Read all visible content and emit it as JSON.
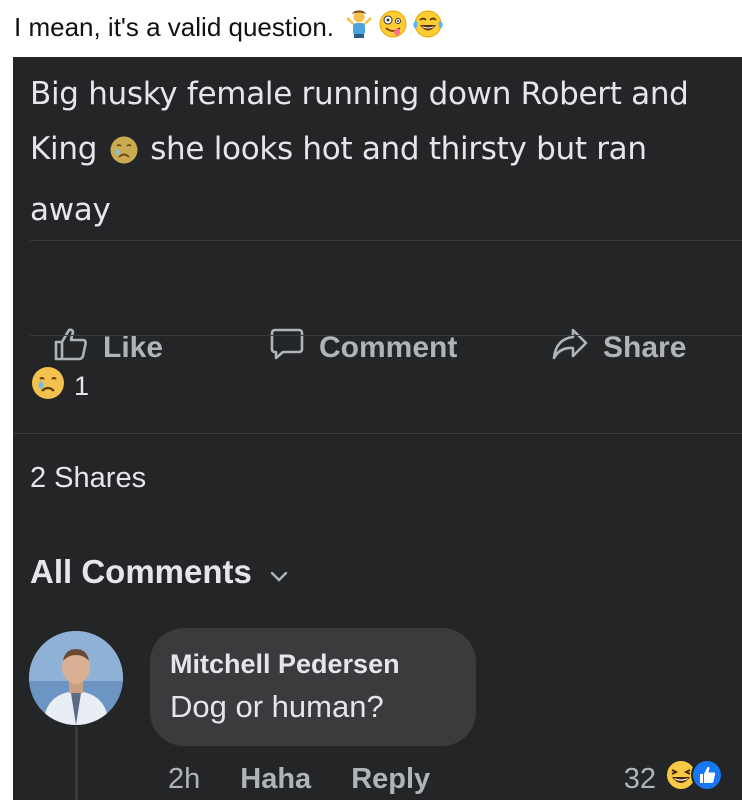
{
  "caption": {
    "text": "I mean, it's a valid question.",
    "emojis": [
      "person-shrugging-icon",
      "zany-face-icon",
      "tears-of-joy-icon"
    ]
  },
  "post": {
    "text_line1": "Big husky female running down Robert and",
    "text_line2_pre": "King",
    "text_line2_post": "she looks hot and thirsty but ran",
    "text_line3": "away",
    "inline_emoji": "sad-face-icon"
  },
  "actions": {
    "like": "Like",
    "comment": "Comment",
    "share": "Share"
  },
  "reactions": {
    "icon": "sad-face-icon",
    "count": "1"
  },
  "shares": "2 Shares",
  "comments_header": "All Comments",
  "comment": {
    "author": "Mitchell Pedersen",
    "text": "Dog or human?",
    "time": "2h",
    "reaction_label": "Haha",
    "reply_label": "Reply",
    "reaction_count": "32",
    "reaction_icons": [
      "haha-icon",
      "like-icon"
    ]
  },
  "colors": {
    "background": "#242526",
    "text": "#e4e6eb",
    "muted": "#b0b3b8",
    "bubble": "#3a3b3c",
    "like_blue": "#1877f2"
  }
}
